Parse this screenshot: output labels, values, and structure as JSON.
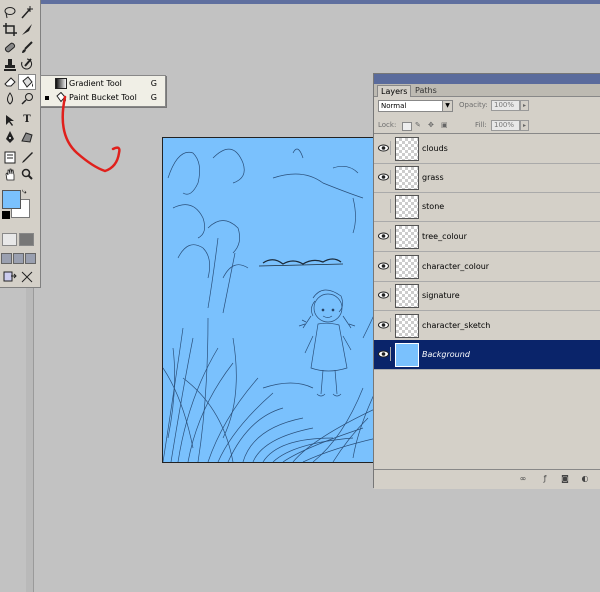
{
  "flyout": {
    "items": [
      {
        "label": "Gradient Tool",
        "shortcut": "G"
      },
      {
        "label": "Paint Bucket Tool",
        "shortcut": "G"
      }
    ]
  },
  "canvas": {
    "fill_color": "#7ac1fd"
  },
  "layers_panel": {
    "tabs": [
      "Layers",
      "Paths"
    ],
    "blend_mode": "Normal",
    "opacity_label": "Opacity:",
    "opacity_value": "100%",
    "lock_label": "Lock:",
    "fill_label": "Fill:",
    "fill_value": "100%",
    "layers": [
      {
        "name": "clouds",
        "visible": true
      },
      {
        "name": "grass",
        "visible": true
      },
      {
        "name": "stone",
        "visible": false
      },
      {
        "name": "tree_colour",
        "visible": true
      },
      {
        "name": "character_colour",
        "visible": true
      },
      {
        "name": "signature",
        "visible": true
      },
      {
        "name": "character_sketch",
        "visible": true
      },
      {
        "name": "Background",
        "visible": true,
        "selected": true
      }
    ]
  },
  "colors": {
    "foreground": "#7ac1fd",
    "background": "#ffffff",
    "selection": "#0a246a",
    "annotation_arrow": "#e0201c"
  }
}
